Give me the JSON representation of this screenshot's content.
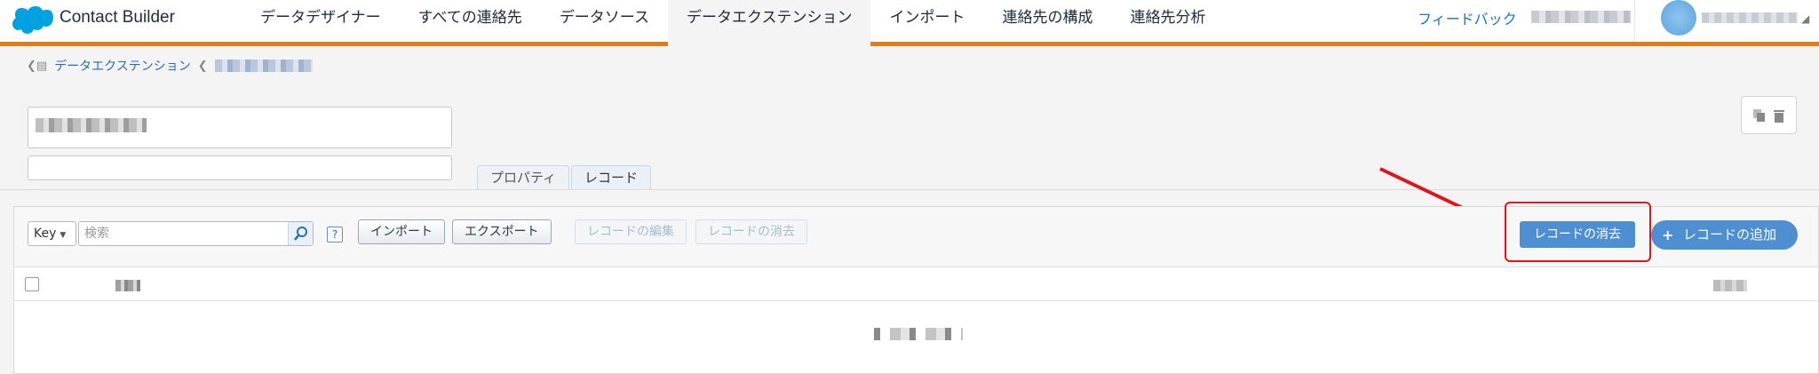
{
  "app": {
    "title": "Contact Builder",
    "brand_color": "#00a1e0",
    "accent_color": "#e07f1a"
  },
  "nav": {
    "items": [
      {
        "label": "データデザイナー"
      },
      {
        "label": "すべての連絡先"
      },
      {
        "label": "データソース"
      },
      {
        "label": "データエクステンション",
        "active": true
      },
      {
        "label": "インポート"
      },
      {
        "label": "連絡先の構成"
      },
      {
        "label": "連絡先分析"
      }
    ],
    "feedback": "フィードバック"
  },
  "breadcrumb": {
    "parent": "データエクステンション"
  },
  "tabs": [
    {
      "label": "プロパティ"
    },
    {
      "label": "レコード",
      "active": true
    }
  ],
  "toolbar": {
    "key_select": "Key",
    "search_placeholder": "検索",
    "help": "?",
    "import": "インポート",
    "export": "エクスポート",
    "edit_records": "レコードの編集",
    "clear_records_disabled": "レコードの消去",
    "clear_records": "レコードの消去",
    "add_plus": "+",
    "add_record": "レコードの追加"
  },
  "highlight_color": "#e0141b"
}
